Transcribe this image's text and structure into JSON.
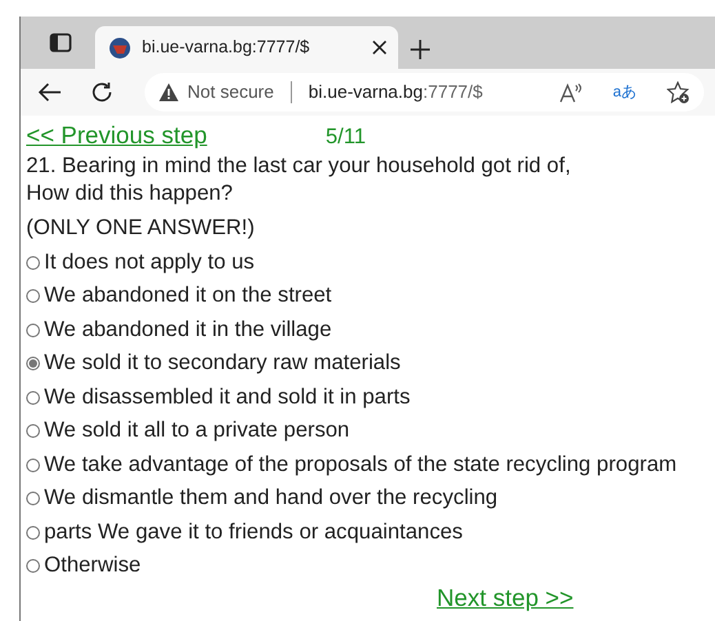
{
  "browser": {
    "tab": {
      "title": "bi.ue-varna.bg:7777/$",
      "selected": true
    },
    "address": {
      "security_label": "Not secure",
      "host": "bi.ue-varna.bg",
      "path": ":7777/$"
    },
    "translate_glyph": "aあ"
  },
  "page": {
    "previous_link": "<< Previous step",
    "progress": "5/11",
    "question": [
      "21. Bearing in mind the last car your household got rid of,",
      "How did this happen?"
    ],
    "instruction": "(ONLY ONE ANSWER!)",
    "options": [
      {
        "label": "It does not apply to us",
        "selected": false
      },
      {
        "label": "We abandoned it on the street",
        "selected": false
      },
      {
        "label": "We abandoned it in the village",
        "selected": false
      },
      {
        "label": "We sold it to secondary raw materials",
        "selected": true
      },
      {
        "label": "We disassembled it and sold it in parts",
        "selected": false
      },
      {
        "label": "We sold it all to a private person",
        "selected": false
      },
      {
        "label": "We take advantage of the proposals of the state recycling program",
        "selected": false
      },
      {
        "label": "We dismantle them and hand over the recycling",
        "selected": false
      },
      {
        "label": "parts We gave it to friends or acquaintances",
        "selected": false
      },
      {
        "label": "Otherwise",
        "selected": false
      }
    ],
    "next_link": "Next step >>"
  }
}
